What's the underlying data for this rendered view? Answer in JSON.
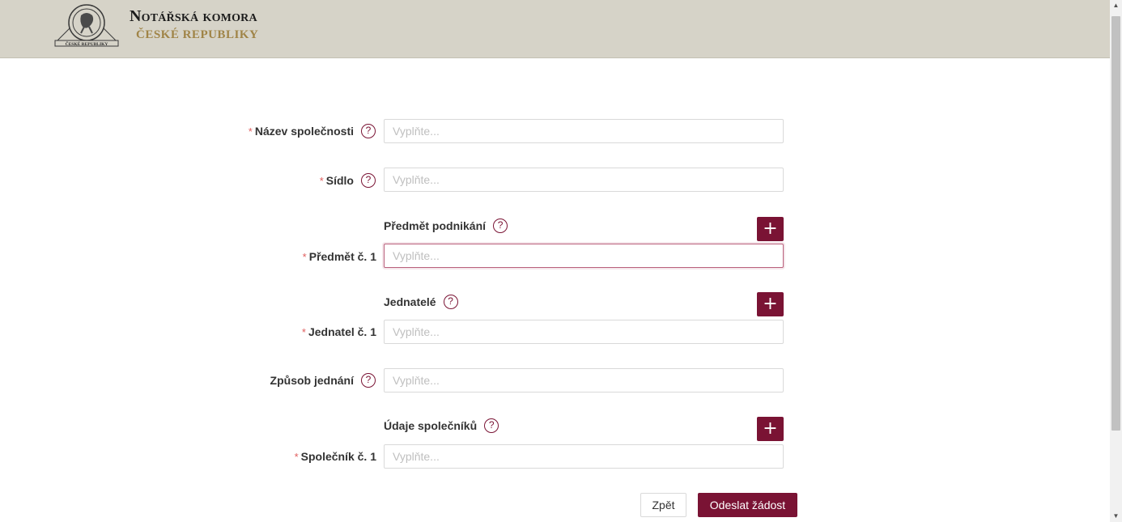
{
  "header": {
    "brand_line1": "Notářská komora",
    "brand_line2": "ČESKÉ REPUBLIKY",
    "seal_text": "ČESKÉ REPUBLIKY"
  },
  "colors": {
    "accent": "#7a1334",
    "header_bg": "#d6d3c8",
    "required": "#e05d5d",
    "gold": "#a08447"
  },
  "form": {
    "company_name": {
      "label": "Název společnosti",
      "required": true,
      "placeholder": "Vyplňte...",
      "value": ""
    },
    "seat": {
      "label": "Sídlo",
      "required": true,
      "placeholder": "Vyplňte...",
      "value": ""
    },
    "business_section": {
      "title": "Předmět podnikání",
      "add_icon": "+"
    },
    "business_item_1": {
      "label": "Předmět č. 1",
      "required": true,
      "placeholder": "Vyplňte...",
      "value": "",
      "focused": true
    },
    "executives_section": {
      "title": "Jednatelé",
      "add_icon": "+"
    },
    "executive_1": {
      "label": "Jednatel č. 1",
      "required": true,
      "placeholder": "Vyplňte...",
      "value": ""
    },
    "acting_method": {
      "label": "Způsob jednání",
      "required": false,
      "placeholder": "Vyplňte...",
      "value": ""
    },
    "partners_section": {
      "title": "Údaje společníků",
      "add_icon": "+"
    },
    "partner_1": {
      "label": "Společník č. 1",
      "required": true,
      "placeholder": "Vyplňte...",
      "value": ""
    },
    "help_glyph": "?",
    "required_mark": "*"
  },
  "actions": {
    "back_label": "Zpět",
    "submit_label": "Odeslat žádost"
  }
}
